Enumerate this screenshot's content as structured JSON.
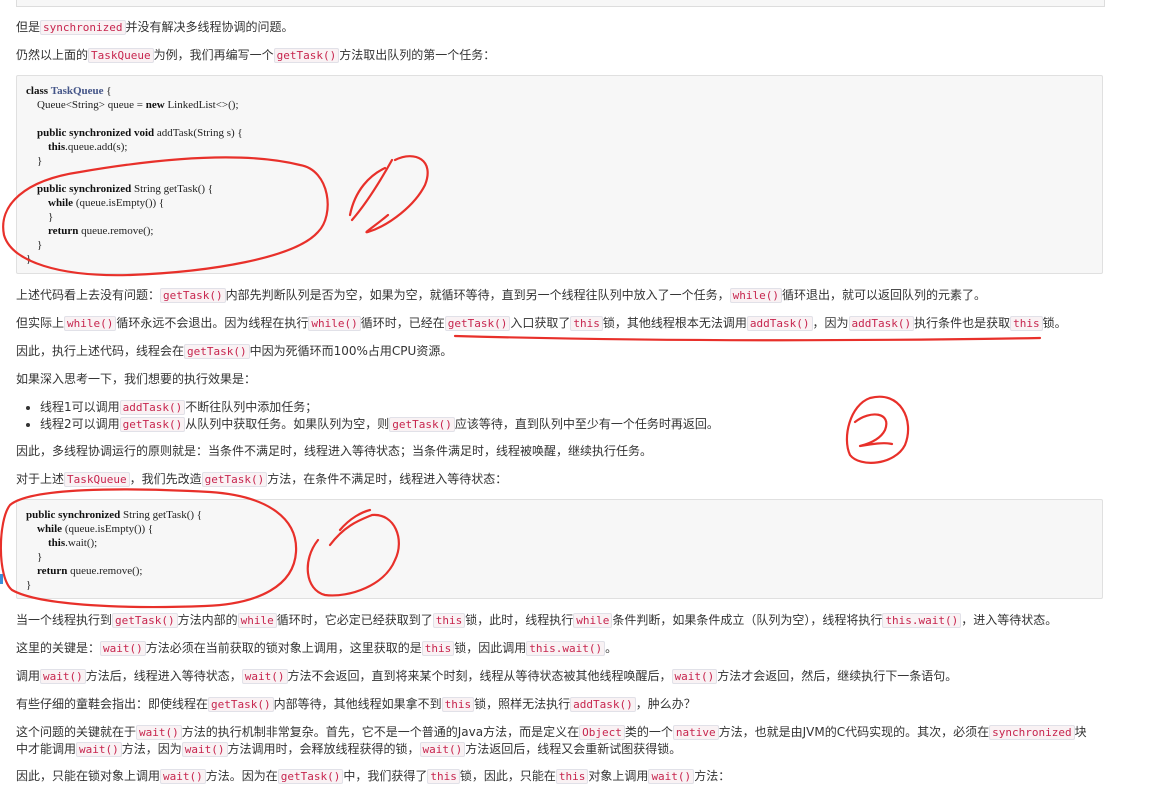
{
  "p1": {
    "a": "但是",
    "c1": "synchronized",
    "b": "并没有解决多线程协调的问题。"
  },
  "p2": {
    "a": "仍然以上面的",
    "c1": "TaskQueue",
    "b": "为例，我们再编写一个",
    "c2": "getTask()",
    "c": "方法取出队列的第一个任务："
  },
  "code1": {
    "l1k": "class",
    "l1n": "TaskQueue",
    "l1b": " {",
    "l2": "    Queue<String> queue = ",
    "l2k": "new",
    "l2b": " LinkedList<>();",
    "l4k": "    public synchronized void",
    "l4b": " addTask(String s) {",
    "l5k": "        this",
    "l5b": ".queue.add(s);",
    "l6": "    }",
    "l8k": "    public synchronized",
    "l8b": " String getTask() {",
    "l9k": "        while",
    "l9b": " (queue.isEmpty()) {",
    "l10": "        }",
    "l11k": "        return",
    "l11b": " queue.remove();",
    "l12": "    }",
    "l13": "}"
  },
  "p3": {
    "a": "上述代码看上去没有问题：",
    "c1": "getTask()",
    "b": "内部先判断队列是否为空，如果为空，就循环等待，直到另一个线程往队列中放入了一个任务，",
    "c2": "while()",
    "c": "循环退出，就可以返回队列的元素了。"
  },
  "p4": {
    "a": "但实际上",
    "c1": "while()",
    "b": "循环永远不会退出。因为线程在执行",
    "c2": "while()",
    "c": "循环时，已经在",
    "c3": "getTask()",
    "d": "入口获取了",
    "c4": "this",
    "e": "锁，其他线程根本无法调用",
    "c5": "addTask()",
    "f": "，因为",
    "c6": "addTask()",
    "g": "执行条件也是获取",
    "c7": "this",
    "h": "锁。"
  },
  "p5": {
    "a": "因此，执行上述代码，线程会在",
    "c1": "getTask()",
    "b": "中因为死循环而100%占用CPU资源。"
  },
  "p6": {
    "a": "如果深入思考一下，我们想要的执行效果是："
  },
  "li1": {
    "a": "线程1可以调用",
    "c1": "addTask()",
    "b": "不断往队列中添加任务；"
  },
  "li2": {
    "a": "线程2可以调用",
    "c1": "getTask()",
    "b": "从队列中获取任务。如果队列为空，则",
    "c2": "getTask()",
    "c": "应该等待，直到队列中至少有一个任务时再返回。"
  },
  "p7": {
    "a": "因此，多线程协调运行的原则就是：当条件不满足时，线程进入等待状态；当条件满足时，线程被唤醒，继续执行任务。"
  },
  "p8": {
    "a": "对于上述",
    "c1": "TaskQueue",
    "b": "，我们先改造",
    "c2": "getTask()",
    "c": "方法，在条件不满足时，线程进入等待状态："
  },
  "code2": {
    "l1k": "public synchronized",
    "l1b": " String getTask() {",
    "l2k": "    while",
    "l2b": " (queue.isEmpty()) {",
    "l3k": "        this",
    "l3b": ".wait();",
    "l4": "    }",
    "l5k": "    return",
    "l5b": " queue.remove();",
    "l6": "}"
  },
  "p9": {
    "a": "当一个线程执行到",
    "c1": "getTask()",
    "b": "方法内部的",
    "c2": "while",
    "c": "循环时，它必定已经获取到了",
    "c3": "this",
    "d": "锁，此时，线程执行",
    "c4": "while",
    "e": "条件判断，如果条件成立（队列为空），线程将执行",
    "c5": "this.wait()",
    "f": "，进入等待状态。"
  },
  "p10": {
    "a": "这里的关键是：",
    "c1": "wait()",
    "b": "方法必须在当前获取的锁对象上调用，这里获取的是",
    "c2": "this",
    "c": "锁，因此调用",
    "c3": "this.wait()",
    "d": "。"
  },
  "p11": {
    "a": "调用",
    "c1": "wait()",
    "b": "方法后，线程进入等待状态，",
    "c2": "wait()",
    "c": "方法不会返回，直到将来某个时刻，线程从等待状态被其他线程唤醒后，",
    "c3": "wait()",
    "d": "方法才会返回，然后，继续执行下一条语句。"
  },
  "p12": {
    "a": "有些仔细的童鞋会指出：即使线程在",
    "c1": "getTask()",
    "b": "内部等待，其他线程如果拿不到",
    "c2": "this",
    "c": "锁，照样无法执行",
    "c3": "addTask()",
    "d": "，肿么办？"
  },
  "p13": {
    "a": "这个问题的关键就在于",
    "c1": "wait()",
    "b": "方法的执行机制非常复杂。首先，它不是一个普通的Java方法，而是定义在",
    "c2": "Object",
    "c": "类的一个",
    "c3": "native",
    "d": "方法，也就是由JVM的C代码实现的。其次，必须在",
    "c4": "synchronized",
    "e": "块",
    "f": "中才能调用",
    "c5": "wait()",
    "g": "方法，因为",
    "c6": "wait()",
    "h": "方法调用时，会释放线程获得的锁，",
    "c7": "wait()",
    "i": "方法返回后，线程又会重新试图获得锁。"
  },
  "p14": {
    "a": "因此，只能在锁对象上调用",
    "c1": "wait()",
    "b": "方法。因为在",
    "c2": "getTask()",
    "c": "中，我们获得了",
    "c3": "this",
    "d": "锁，因此，只能在",
    "c4": "this",
    "e": "对象上调用",
    "c5": "wait()",
    "f": "方法："
  },
  "colors": {
    "annotation": "#e8302a",
    "inline_code": "#c7254e"
  }
}
